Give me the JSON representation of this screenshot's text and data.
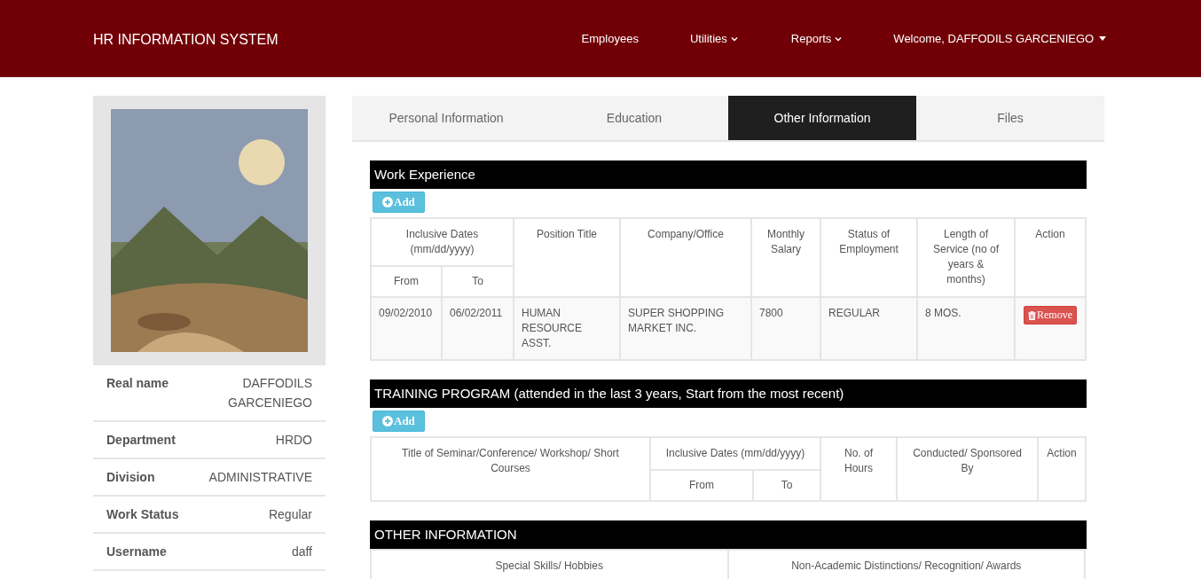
{
  "navbar": {
    "brand": "HR INFORMATION SYSTEM",
    "items": [
      {
        "label": "Employees",
        "kind": "link"
      },
      {
        "label": "Utilities",
        "kind": "dropdown"
      },
      {
        "label": "Reports",
        "kind": "dropdown"
      },
      {
        "label": "Welcome, DAFFODILS GARCENIEGO",
        "kind": "usermenu"
      }
    ]
  },
  "profile": {
    "fields": [
      {
        "label": "Real name",
        "value": "DAFFODILS GARCENIEGO"
      },
      {
        "label": "Department",
        "value": "HRDO"
      },
      {
        "label": "Division",
        "value": "ADMINISTRATIVE"
      },
      {
        "label": "Work Status",
        "value": "Regular"
      },
      {
        "label": "Username",
        "value": "daff"
      }
    ]
  },
  "tabs": [
    {
      "label": "Personal Information",
      "selected": false
    },
    {
      "label": "Education",
      "selected": false
    },
    {
      "label": "Other Information",
      "selected": true
    },
    {
      "label": "Files",
      "selected": false
    }
  ],
  "work_experience": {
    "title": "Work Experience",
    "add_button": "Add",
    "dates_header": "Inclusive Dates (mm/dd/yyyy)",
    "from": "From",
    "to": "To",
    "columns": [
      "Position Title",
      "Company/Office",
      "Monthly Salary",
      "Status of Employment",
      "Length of Service (no of years & months)",
      "Action"
    ],
    "rows": [
      {
        "from": "09/02/2010",
        "to": "06/02/2011",
        "position": "HUMAN RESOURCE ASST.",
        "company": "SUPER SHOPPING MARKET INC.",
        "salary": "7800",
        "status": "REGULAR",
        "length": "8 MOS.",
        "action": "Remove"
      }
    ]
  },
  "training_program": {
    "title": "TRAINING PROGRAM (attended in the last 3 years, Start from the most recent)",
    "add_button": "Add",
    "title_column": "Title of Seminar/Conference/ Workshop/ Short Courses",
    "dates_header": "Inclusive Dates (mm/dd/yyyy)",
    "from": "From",
    "to": "To",
    "columns": [
      "No. of Hours",
      "Conducted/ Sponsored By",
      "Action"
    ]
  },
  "other_information": {
    "title": "OTHER INFORMATION",
    "columns": [
      "Special Skills/ Hobbies",
      "Non-Academic Distinctions/ Recognition/ Awards"
    ]
  }
}
